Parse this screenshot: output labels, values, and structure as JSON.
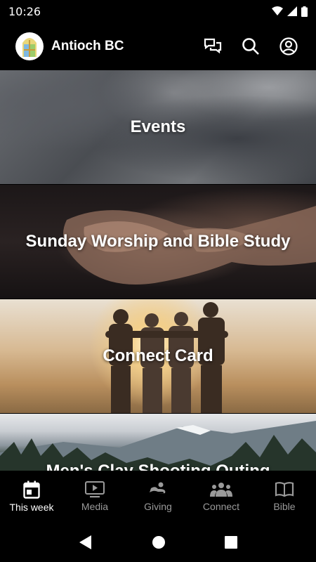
{
  "status_bar": {
    "time": "10:26",
    "icons": [
      "wifi-icon",
      "signal-icon",
      "battery-icon"
    ]
  },
  "app_bar": {
    "title": "Antioch BC",
    "actions": [
      "chat-icon",
      "search-icon",
      "account-icon"
    ]
  },
  "feed": {
    "cards": [
      {
        "title": "Events"
      },
      {
        "title": "Sunday Worship and Bible Study"
      },
      {
        "title": "Connect Card"
      },
      {
        "title": "Men's Clay Shooting Outing"
      }
    ]
  },
  "bottom_nav": {
    "items": [
      {
        "label": "This week",
        "icon": "calendar-icon",
        "active": true
      },
      {
        "label": "Media",
        "icon": "video-icon",
        "active": false
      },
      {
        "label": "Giving",
        "icon": "giving-icon",
        "active": false
      },
      {
        "label": "Connect",
        "icon": "group-icon",
        "active": false
      },
      {
        "label": "Bible",
        "icon": "book-icon",
        "active": false
      }
    ]
  },
  "system_nav": [
    "back-icon",
    "home-icon",
    "recents-icon"
  ],
  "colors": {
    "background": "#000000",
    "active": "#ffffff",
    "inactive": "#9a9a9a"
  }
}
